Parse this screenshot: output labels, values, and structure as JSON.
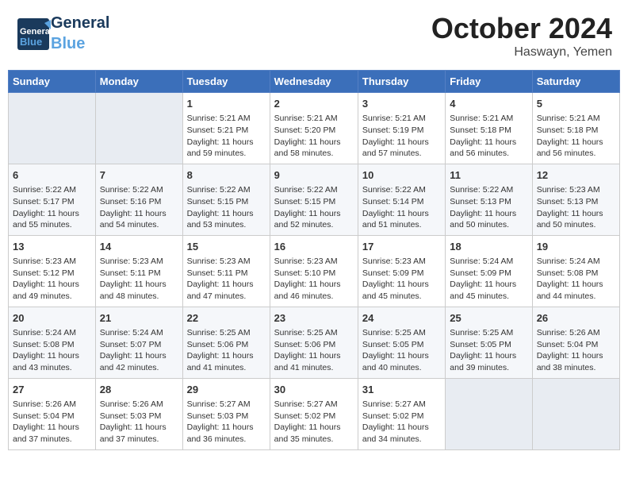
{
  "logo": {
    "text_general": "General",
    "text_blue": "Blue"
  },
  "title": "October 2024",
  "subtitle": "Haswayn, Yemen",
  "days_header": [
    "Sunday",
    "Monday",
    "Tuesday",
    "Wednesday",
    "Thursday",
    "Friday",
    "Saturday"
  ],
  "weeks": [
    [
      {
        "day": "",
        "info": ""
      },
      {
        "day": "",
        "info": ""
      },
      {
        "day": "1",
        "sunrise": "5:21 AM",
        "sunset": "5:21 PM",
        "daylight": "11 hours and 59 minutes."
      },
      {
        "day": "2",
        "sunrise": "5:21 AM",
        "sunset": "5:20 PM",
        "daylight": "11 hours and 58 minutes."
      },
      {
        "day": "3",
        "sunrise": "5:21 AM",
        "sunset": "5:19 PM",
        "daylight": "11 hours and 57 minutes."
      },
      {
        "day": "4",
        "sunrise": "5:21 AM",
        "sunset": "5:18 PM",
        "daylight": "11 hours and 56 minutes."
      },
      {
        "day": "5",
        "sunrise": "5:21 AM",
        "sunset": "5:18 PM",
        "daylight": "11 hours and 56 minutes."
      }
    ],
    [
      {
        "day": "6",
        "sunrise": "5:22 AM",
        "sunset": "5:17 PM",
        "daylight": "11 hours and 55 minutes."
      },
      {
        "day": "7",
        "sunrise": "5:22 AM",
        "sunset": "5:16 PM",
        "daylight": "11 hours and 54 minutes."
      },
      {
        "day": "8",
        "sunrise": "5:22 AM",
        "sunset": "5:15 PM",
        "daylight": "11 hours and 53 minutes."
      },
      {
        "day": "9",
        "sunrise": "5:22 AM",
        "sunset": "5:15 PM",
        "daylight": "11 hours and 52 minutes."
      },
      {
        "day": "10",
        "sunrise": "5:22 AM",
        "sunset": "5:14 PM",
        "daylight": "11 hours and 51 minutes."
      },
      {
        "day": "11",
        "sunrise": "5:22 AM",
        "sunset": "5:13 PM",
        "daylight": "11 hours and 50 minutes."
      },
      {
        "day": "12",
        "sunrise": "5:23 AM",
        "sunset": "5:13 PM",
        "daylight": "11 hours and 50 minutes."
      }
    ],
    [
      {
        "day": "13",
        "sunrise": "5:23 AM",
        "sunset": "5:12 PM",
        "daylight": "11 hours and 49 minutes."
      },
      {
        "day": "14",
        "sunrise": "5:23 AM",
        "sunset": "5:11 PM",
        "daylight": "11 hours and 48 minutes."
      },
      {
        "day": "15",
        "sunrise": "5:23 AM",
        "sunset": "5:11 PM",
        "daylight": "11 hours and 47 minutes."
      },
      {
        "day": "16",
        "sunrise": "5:23 AM",
        "sunset": "5:10 PM",
        "daylight": "11 hours and 46 minutes."
      },
      {
        "day": "17",
        "sunrise": "5:23 AM",
        "sunset": "5:09 PM",
        "daylight": "11 hours and 45 minutes."
      },
      {
        "day": "18",
        "sunrise": "5:24 AM",
        "sunset": "5:09 PM",
        "daylight": "11 hours and 45 minutes."
      },
      {
        "day": "19",
        "sunrise": "5:24 AM",
        "sunset": "5:08 PM",
        "daylight": "11 hours and 44 minutes."
      }
    ],
    [
      {
        "day": "20",
        "sunrise": "5:24 AM",
        "sunset": "5:08 PM",
        "daylight": "11 hours and 43 minutes."
      },
      {
        "day": "21",
        "sunrise": "5:24 AM",
        "sunset": "5:07 PM",
        "daylight": "11 hours and 42 minutes."
      },
      {
        "day": "22",
        "sunrise": "5:25 AM",
        "sunset": "5:06 PM",
        "daylight": "11 hours and 41 minutes."
      },
      {
        "day": "23",
        "sunrise": "5:25 AM",
        "sunset": "5:06 PM",
        "daylight": "11 hours and 41 minutes."
      },
      {
        "day": "24",
        "sunrise": "5:25 AM",
        "sunset": "5:05 PM",
        "daylight": "11 hours and 40 minutes."
      },
      {
        "day": "25",
        "sunrise": "5:25 AM",
        "sunset": "5:05 PM",
        "daylight": "11 hours and 39 minutes."
      },
      {
        "day": "26",
        "sunrise": "5:26 AM",
        "sunset": "5:04 PM",
        "daylight": "11 hours and 38 minutes."
      }
    ],
    [
      {
        "day": "27",
        "sunrise": "5:26 AM",
        "sunset": "5:04 PM",
        "daylight": "11 hours and 37 minutes."
      },
      {
        "day": "28",
        "sunrise": "5:26 AM",
        "sunset": "5:03 PM",
        "daylight": "11 hours and 37 minutes."
      },
      {
        "day": "29",
        "sunrise": "5:27 AM",
        "sunset": "5:03 PM",
        "daylight": "11 hours and 36 minutes."
      },
      {
        "day": "30",
        "sunrise": "5:27 AM",
        "sunset": "5:02 PM",
        "daylight": "11 hours and 35 minutes."
      },
      {
        "day": "31",
        "sunrise": "5:27 AM",
        "sunset": "5:02 PM",
        "daylight": "11 hours and 34 minutes."
      },
      {
        "day": "",
        "info": ""
      },
      {
        "day": "",
        "info": ""
      }
    ]
  ]
}
